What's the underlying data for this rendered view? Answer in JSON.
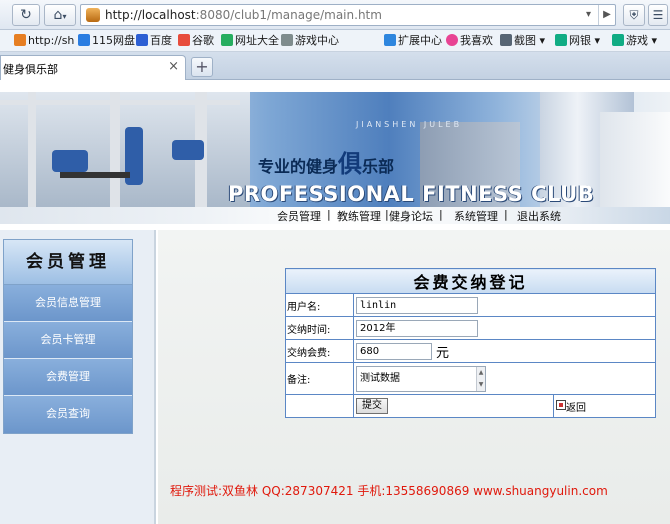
{
  "browser": {
    "url_host": "http://localhost",
    "url_rest": ":8080/club1/manage/main.htm",
    "tab_title": "健身俱乐部",
    "close_glyph": "×",
    "newtab_glyph": "+",
    "bookmarks": [
      {
        "label": "http://sh",
        "icon": "weibo-icon",
        "color": "#e67e22"
      },
      {
        "label": "115网盘",
        "icon": "cloud-icon",
        "color": "#2a7de1"
      },
      {
        "label": "百度",
        "icon": "baidu-paw-icon",
        "color": "#2d5fd3"
      },
      {
        "label": "谷歌",
        "icon": "google-icon",
        "color": "#e74c3c"
      },
      {
        "label": "网址大全",
        "icon": "nav-site-icon",
        "color": "#27ae60"
      },
      {
        "label": "游戏中心",
        "icon": "gamepad-icon",
        "color": "#7f8c8d"
      }
    ],
    "right_bookmarks": [
      {
        "label": "扩展中心",
        "icon": "puzzle-icon",
        "color": "#2e86de"
      },
      {
        "label": "我喜欢",
        "icon": "heart-icon",
        "color": "#e84393"
      },
      {
        "label": "截图",
        "icon": "scissors-icon",
        "color": "#576574"
      },
      {
        "label": "网银",
        "icon": "bank-icon",
        "color": "#10ac84"
      },
      {
        "label": "游戏",
        "icon": "controller-icon",
        "color": "#10ac84"
      }
    ]
  },
  "banner": {
    "slogan_a": "专业的健身",
    "slogan_b": "俱",
    "slogan_c": "乐部",
    "english": "PROFESSIONAL FITNESS CLUB",
    "jiansh": "JIANSHEN JULEB"
  },
  "nav": [
    "会员管理",
    "教练管理",
    "健身论坛",
    "系统管理",
    "退出系统"
  ],
  "nav_sep": "|",
  "sidebar": {
    "title": "会员管理",
    "items": [
      "会员信息管理",
      "会员卡管理",
      "会费管理",
      "会员查询"
    ]
  },
  "form": {
    "title": "会费交纳登记",
    "username_label": "用户名:",
    "username_value": "linlin",
    "time_label": "交纳时间:",
    "time_value": "2012年",
    "fee_label": "交纳会费:",
    "fee_value": "680",
    "fee_unit": "元",
    "note_label": "备注:",
    "note_value": "测试数据",
    "submit_label": "提交",
    "back_label": "返回"
  },
  "footer": "程序测试:双鱼林 QQ:287307421 手机:13558690869 www.shuangyulin.com"
}
